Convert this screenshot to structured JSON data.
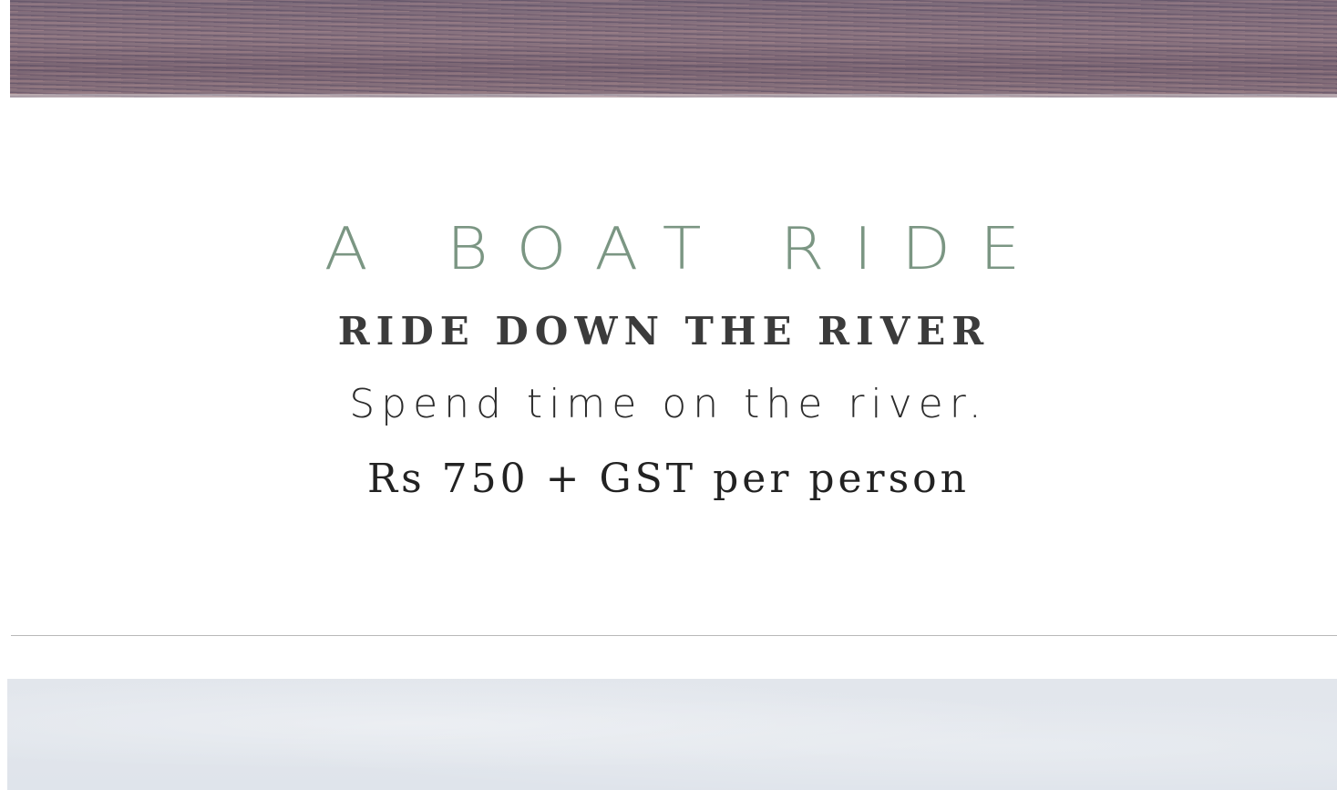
{
  "hero": {
    "eyebrow": "A BOAT RIDE",
    "subtitle": "RIDE DOWN THE RIVER",
    "description": "Spend time on the river.",
    "price": "Rs 750 + GST per person"
  },
  "colors": {
    "eyebrow": "#7b9683",
    "subtitle": "#3b3b3b",
    "body": "#222222",
    "divider": "#b9b9b9"
  }
}
